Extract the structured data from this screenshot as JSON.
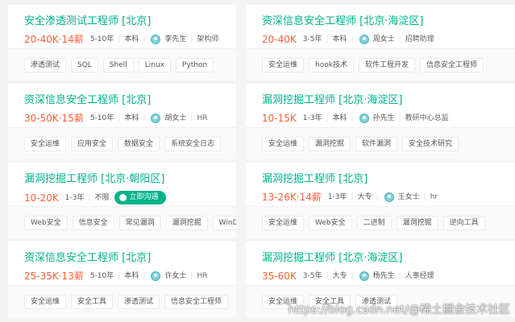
{
  "jobs": [
    {
      "title": "安全渗透测试工程师  [北京]",
      "salary": "20-40K·14薪",
      "exp": "5-10年",
      "edu": "本科",
      "recruiter": "李先生",
      "position": "架构师",
      "tags": [
        "渗透测试",
        "SQL",
        "Shell",
        "Linux",
        "Python"
      ]
    },
    {
      "title": "资深信息安全工程师  [北京·海淀区]",
      "salary": "20-40K",
      "exp": "3-5年",
      "edu": "本科",
      "recruiter": "周女士",
      "position": "招聘助理",
      "tags": [
        "安全运维",
        "hook技术",
        "软件工程开发",
        "信息安全工程师"
      ]
    },
    {
      "title": "资深信息安全工程师  [北京]",
      "salary": "30-50K·15薪",
      "exp": "5-10年",
      "edu": "本科",
      "recruiter": "胡女士",
      "position": "HR",
      "tags": [
        "安全运维",
        "应用安全",
        "数据安全",
        "系统安全日志"
      ]
    },
    {
      "title": "漏洞挖掘工程师  [北京·海淀区]",
      "salary": "10-15K",
      "exp": "1-3年",
      "edu": "本科",
      "recruiter": "孙先生",
      "position": "教研中心总监",
      "tags": [
        "安全运维",
        "漏洞挖掘",
        "软件漏洞",
        "安全技术研究"
      ]
    },
    {
      "title": "漏洞挖掘工程师  [北京·朝阳区]",
      "salary": "10-20K",
      "exp": "1-3年",
      "edu": "不限",
      "chat": "立即沟通",
      "tags": [
        "Web安全",
        "信息安全",
        "常见漏洞",
        "漏洞挖掘",
        "WinDbg"
      ]
    },
    {
      "title": "漏洞挖掘工程师  [北京]",
      "salary": "13-26K·14薪",
      "exp": "1-3年",
      "edu": "大专",
      "recruiter": "王女士",
      "position": "hr",
      "tags": [
        "安全运维",
        "Web安全",
        "二进制",
        "漏洞挖掘",
        "逆向工具"
      ]
    },
    {
      "title": "资深信息安全工程师  [北京]",
      "salary": "25-35K·13薪",
      "exp": "5-10年",
      "edu": "本科",
      "recruiter": "许女士",
      "position": "HR",
      "tags": [
        "安全运维",
        "安全工具",
        "渗透测试",
        "信息安全工程师"
      ]
    },
    {
      "title": "漏洞挖掘工程师  [北京·海淀区]",
      "salary": "35-60K",
      "exp": "3-5年",
      "edu": "大专",
      "recruiter": "杨先生",
      "position": "人事经理",
      "tags": [
        "安全运维",
        "安全工具",
        "渗透测试"
      ]
    }
  ],
  "watermark": "https://blog.csdn.net/@稀土掘金技术社区",
  "colors": {
    "accent": "#00b38a",
    "salary": "#fd5f39"
  }
}
